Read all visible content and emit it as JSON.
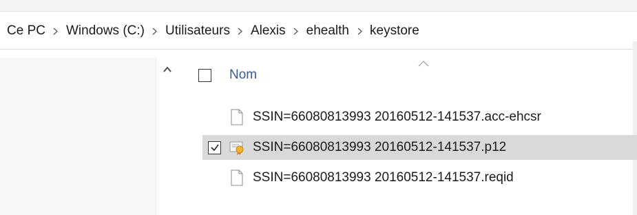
{
  "breadcrumb": [
    "Ce PC",
    "Windows (C:)",
    "Utilisateurs",
    "Alexis",
    "ehealth",
    "keystore"
  ],
  "columns": {
    "name": "Nom"
  },
  "files": [
    {
      "name": "SSIN=66080813993 20160512-141537.acc-ehcsr",
      "icon": "blank-file-icon",
      "selected": false,
      "checked": false
    },
    {
      "name": "SSIN=66080813993 20160512-141537.p12",
      "icon": "certificate-file-icon",
      "selected": true,
      "checked": true
    },
    {
      "name": "SSIN=66080813993 20160512-141537.reqid",
      "icon": "blank-file-icon",
      "selected": false,
      "checked": false
    }
  ],
  "colors": {
    "selection": "#d9d9d9",
    "header_text": "#3a5a8c",
    "nav_pane": "#f7f7f7"
  }
}
